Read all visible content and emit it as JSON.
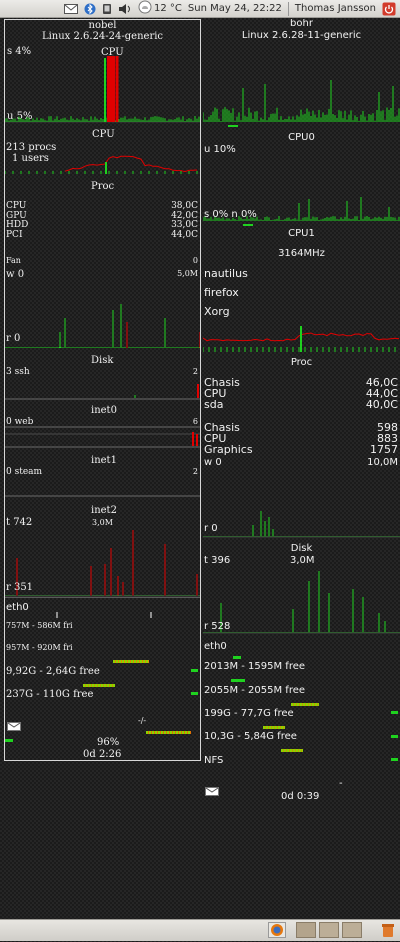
{
  "topbar": {
    "temperature": "12 °C",
    "datetime": "Sun May 24, 22:22",
    "user": "Thomas Jansson"
  },
  "colors": {
    "green": "#1fd21f",
    "red": "#e00000",
    "lime": "#8bd400",
    "panel_border": "#d8d8d8"
  },
  "left": {
    "hostname": "nobel",
    "kernel": "Linux 2.6.24-24-generic",
    "cpu_title": "CPU",
    "cpu_s": "s 4%",
    "cpu_u": "u 5%",
    "cpu2_title": "CPU",
    "procs": "213 procs",
    "users": "1 users",
    "proc_title": "Proc",
    "sensors": [
      {
        "name": "CPU",
        "value": "38,0C"
      },
      {
        "name": "GPU",
        "value": "42,0C"
      },
      {
        "name": "HDD",
        "value": "33,0C"
      },
      {
        "name": "PCI",
        "value": "44,0C"
      }
    ],
    "fan_label": "Fan",
    "fan_value": "0",
    "disk_w": "w 0",
    "disk_w_scale": "5,0M",
    "disk_r": "r 0",
    "disk_title": "Disk",
    "ssh_label": "3 ssh",
    "ssh_scale": "2",
    "inet0_title": "inet0",
    "web_label": "0 web",
    "web_scale": "6",
    "inet1_title": "inet1",
    "steam_label": "0 steam",
    "steam_scale": "2",
    "inet2_title": "inet2",
    "net_t": "t 742",
    "net_scale": "3,0M",
    "net_r": "r 351",
    "eth_label": "eth0",
    "mem1": "757M - 586M fri",
    "mem2": "957M - 920M fri",
    "fs1": "9,92G - 2,64G free",
    "fs2": "237G - 110G free",
    "fs_path": "-/-",
    "battery": "96%",
    "uptime": "0d  2:26"
  },
  "right": {
    "hostname": "bohr",
    "kernel": "Linux 2.6.28-11-generic",
    "cpu0_title": "CPU0",
    "cpu0_u": "u 10%",
    "cpu1_s": "s 0%  n 0%",
    "cpu1_title": "CPU1",
    "freq": "3164MHz",
    "top": [
      "nautilus",
      "firefox",
      "Xorg"
    ],
    "proc_title": "Proc",
    "temps": [
      {
        "name": "Chasis",
        "value": "46,0C"
      },
      {
        "name": "CPU",
        "value": "44,0C"
      },
      {
        "name": "sda",
        "value": "40,0C"
      }
    ],
    "fans": [
      {
        "name": "Chasis",
        "value": "598"
      },
      {
        "name": "CPU",
        "value": "883"
      },
      {
        "name": "Graphics",
        "value": "1757"
      }
    ],
    "disk_w": "w 0",
    "disk_w_scale": "10,0M",
    "disk_r": "r  0",
    "disk_title": "Disk",
    "net_t": "t  396",
    "net_scale": "3,0M",
    "net_r": "r  528",
    "eth_label": "eth0",
    "mem1": "2013M - 1595M free",
    "mem2": "2055M - 2055M free",
    "fs1": "199G - 77,7G free",
    "fs2": "10,3G - 5,84G free",
    "nfs": "NFS",
    "dash": "-",
    "uptime": "0d  0:39"
  }
}
